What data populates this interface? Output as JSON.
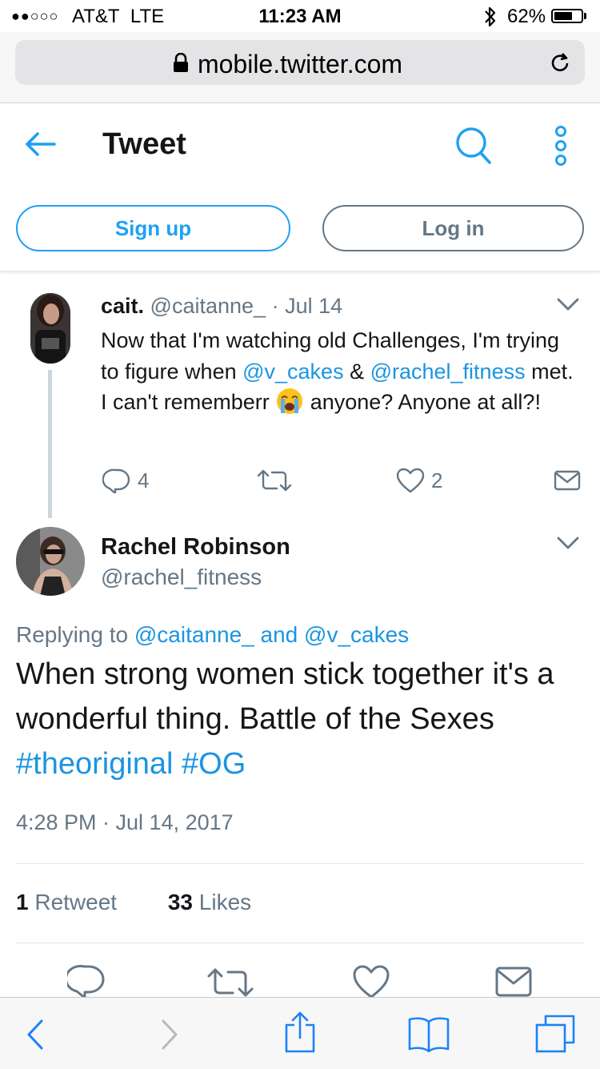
{
  "status_bar": {
    "carrier": "AT&T",
    "network": "LTE",
    "time": "11:23 AM",
    "battery": "62%"
  },
  "browser": {
    "url": "mobile.twitter.com"
  },
  "header": {
    "title": "Tweet",
    "signup_label": "Sign up",
    "login_label": "Log in"
  },
  "parent_tweet": {
    "name": "cait.",
    "handle": "@caitanne_",
    "separator": "·",
    "date": "Jul 14",
    "text_part1": "Now that I'm watching old Challenges, I'm trying to figure when ",
    "mention1": "@v_cakes",
    "text_part2": " & ",
    "mention2": "@rachel_fitness",
    "text_part3": " met. I can't rememberr ",
    "text_part4": " anyone? Anyone at all?!",
    "reply_count": "4",
    "like_count": "2"
  },
  "main_tweet": {
    "name": "Rachel Robinson",
    "handle": "@rachel_fitness",
    "replying_prefix": "Replying to",
    "replying_to_1": "@caitanne_",
    "replying_and": "and",
    "replying_to_2": "@v_cakes",
    "body_text": "When strong women stick together it's a wonderful thing. Battle of the Sexes ",
    "hashtag1": "#theoriginal",
    "hashtag2": "#OG",
    "timestamp": "4:28 PM · Jul 14, 2017",
    "retweet_count": "1",
    "retweet_label": "Retweet",
    "like_count": "33",
    "like_label": "Likes"
  },
  "colors": {
    "accent": "#1da1f2",
    "link": "#1b95e0",
    "muted": "#657786",
    "safari_blue": "#1a82fb"
  }
}
